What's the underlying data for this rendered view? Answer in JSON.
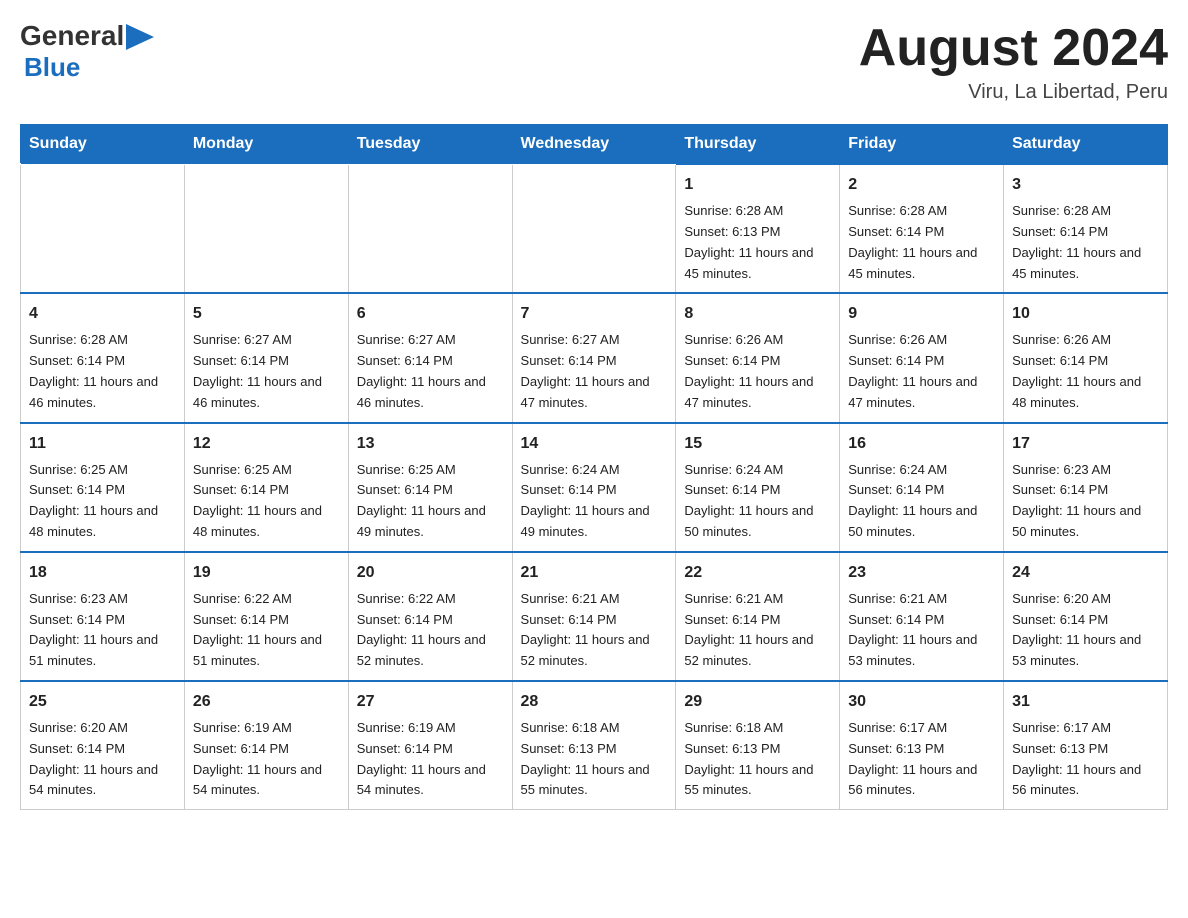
{
  "header": {
    "logo": {
      "general": "General",
      "blue": "Blue"
    },
    "title": "August 2024",
    "location": "Viru, La Libertad, Peru"
  },
  "days_of_week": [
    "Sunday",
    "Monday",
    "Tuesday",
    "Wednesday",
    "Thursday",
    "Friday",
    "Saturday"
  ],
  "weeks": [
    {
      "cells": [
        {
          "day": "",
          "info": ""
        },
        {
          "day": "",
          "info": ""
        },
        {
          "day": "",
          "info": ""
        },
        {
          "day": "",
          "info": ""
        },
        {
          "day": "1",
          "info": "Sunrise: 6:28 AM\nSunset: 6:13 PM\nDaylight: 11 hours and 45 minutes."
        },
        {
          "day": "2",
          "info": "Sunrise: 6:28 AM\nSunset: 6:14 PM\nDaylight: 11 hours and 45 minutes."
        },
        {
          "day": "3",
          "info": "Sunrise: 6:28 AM\nSunset: 6:14 PM\nDaylight: 11 hours and 45 minutes."
        }
      ]
    },
    {
      "cells": [
        {
          "day": "4",
          "info": "Sunrise: 6:28 AM\nSunset: 6:14 PM\nDaylight: 11 hours and 46 minutes."
        },
        {
          "day": "5",
          "info": "Sunrise: 6:27 AM\nSunset: 6:14 PM\nDaylight: 11 hours and 46 minutes."
        },
        {
          "day": "6",
          "info": "Sunrise: 6:27 AM\nSunset: 6:14 PM\nDaylight: 11 hours and 46 minutes."
        },
        {
          "day": "7",
          "info": "Sunrise: 6:27 AM\nSunset: 6:14 PM\nDaylight: 11 hours and 47 minutes."
        },
        {
          "day": "8",
          "info": "Sunrise: 6:26 AM\nSunset: 6:14 PM\nDaylight: 11 hours and 47 minutes."
        },
        {
          "day": "9",
          "info": "Sunrise: 6:26 AM\nSunset: 6:14 PM\nDaylight: 11 hours and 47 minutes."
        },
        {
          "day": "10",
          "info": "Sunrise: 6:26 AM\nSunset: 6:14 PM\nDaylight: 11 hours and 48 minutes."
        }
      ]
    },
    {
      "cells": [
        {
          "day": "11",
          "info": "Sunrise: 6:25 AM\nSunset: 6:14 PM\nDaylight: 11 hours and 48 minutes."
        },
        {
          "day": "12",
          "info": "Sunrise: 6:25 AM\nSunset: 6:14 PM\nDaylight: 11 hours and 48 minutes."
        },
        {
          "day": "13",
          "info": "Sunrise: 6:25 AM\nSunset: 6:14 PM\nDaylight: 11 hours and 49 minutes."
        },
        {
          "day": "14",
          "info": "Sunrise: 6:24 AM\nSunset: 6:14 PM\nDaylight: 11 hours and 49 minutes."
        },
        {
          "day": "15",
          "info": "Sunrise: 6:24 AM\nSunset: 6:14 PM\nDaylight: 11 hours and 50 minutes."
        },
        {
          "day": "16",
          "info": "Sunrise: 6:24 AM\nSunset: 6:14 PM\nDaylight: 11 hours and 50 minutes."
        },
        {
          "day": "17",
          "info": "Sunrise: 6:23 AM\nSunset: 6:14 PM\nDaylight: 11 hours and 50 minutes."
        }
      ]
    },
    {
      "cells": [
        {
          "day": "18",
          "info": "Sunrise: 6:23 AM\nSunset: 6:14 PM\nDaylight: 11 hours and 51 minutes."
        },
        {
          "day": "19",
          "info": "Sunrise: 6:22 AM\nSunset: 6:14 PM\nDaylight: 11 hours and 51 minutes."
        },
        {
          "day": "20",
          "info": "Sunrise: 6:22 AM\nSunset: 6:14 PM\nDaylight: 11 hours and 52 minutes."
        },
        {
          "day": "21",
          "info": "Sunrise: 6:21 AM\nSunset: 6:14 PM\nDaylight: 11 hours and 52 minutes."
        },
        {
          "day": "22",
          "info": "Sunrise: 6:21 AM\nSunset: 6:14 PM\nDaylight: 11 hours and 52 minutes."
        },
        {
          "day": "23",
          "info": "Sunrise: 6:21 AM\nSunset: 6:14 PM\nDaylight: 11 hours and 53 minutes."
        },
        {
          "day": "24",
          "info": "Sunrise: 6:20 AM\nSunset: 6:14 PM\nDaylight: 11 hours and 53 minutes."
        }
      ]
    },
    {
      "cells": [
        {
          "day": "25",
          "info": "Sunrise: 6:20 AM\nSunset: 6:14 PM\nDaylight: 11 hours and 54 minutes."
        },
        {
          "day": "26",
          "info": "Sunrise: 6:19 AM\nSunset: 6:14 PM\nDaylight: 11 hours and 54 minutes."
        },
        {
          "day": "27",
          "info": "Sunrise: 6:19 AM\nSunset: 6:14 PM\nDaylight: 11 hours and 54 minutes."
        },
        {
          "day": "28",
          "info": "Sunrise: 6:18 AM\nSunset: 6:13 PM\nDaylight: 11 hours and 55 minutes."
        },
        {
          "day": "29",
          "info": "Sunrise: 6:18 AM\nSunset: 6:13 PM\nDaylight: 11 hours and 55 minutes."
        },
        {
          "day": "30",
          "info": "Sunrise: 6:17 AM\nSunset: 6:13 PM\nDaylight: 11 hours and 56 minutes."
        },
        {
          "day": "31",
          "info": "Sunrise: 6:17 AM\nSunset: 6:13 PM\nDaylight: 11 hours and 56 minutes."
        }
      ]
    }
  ]
}
